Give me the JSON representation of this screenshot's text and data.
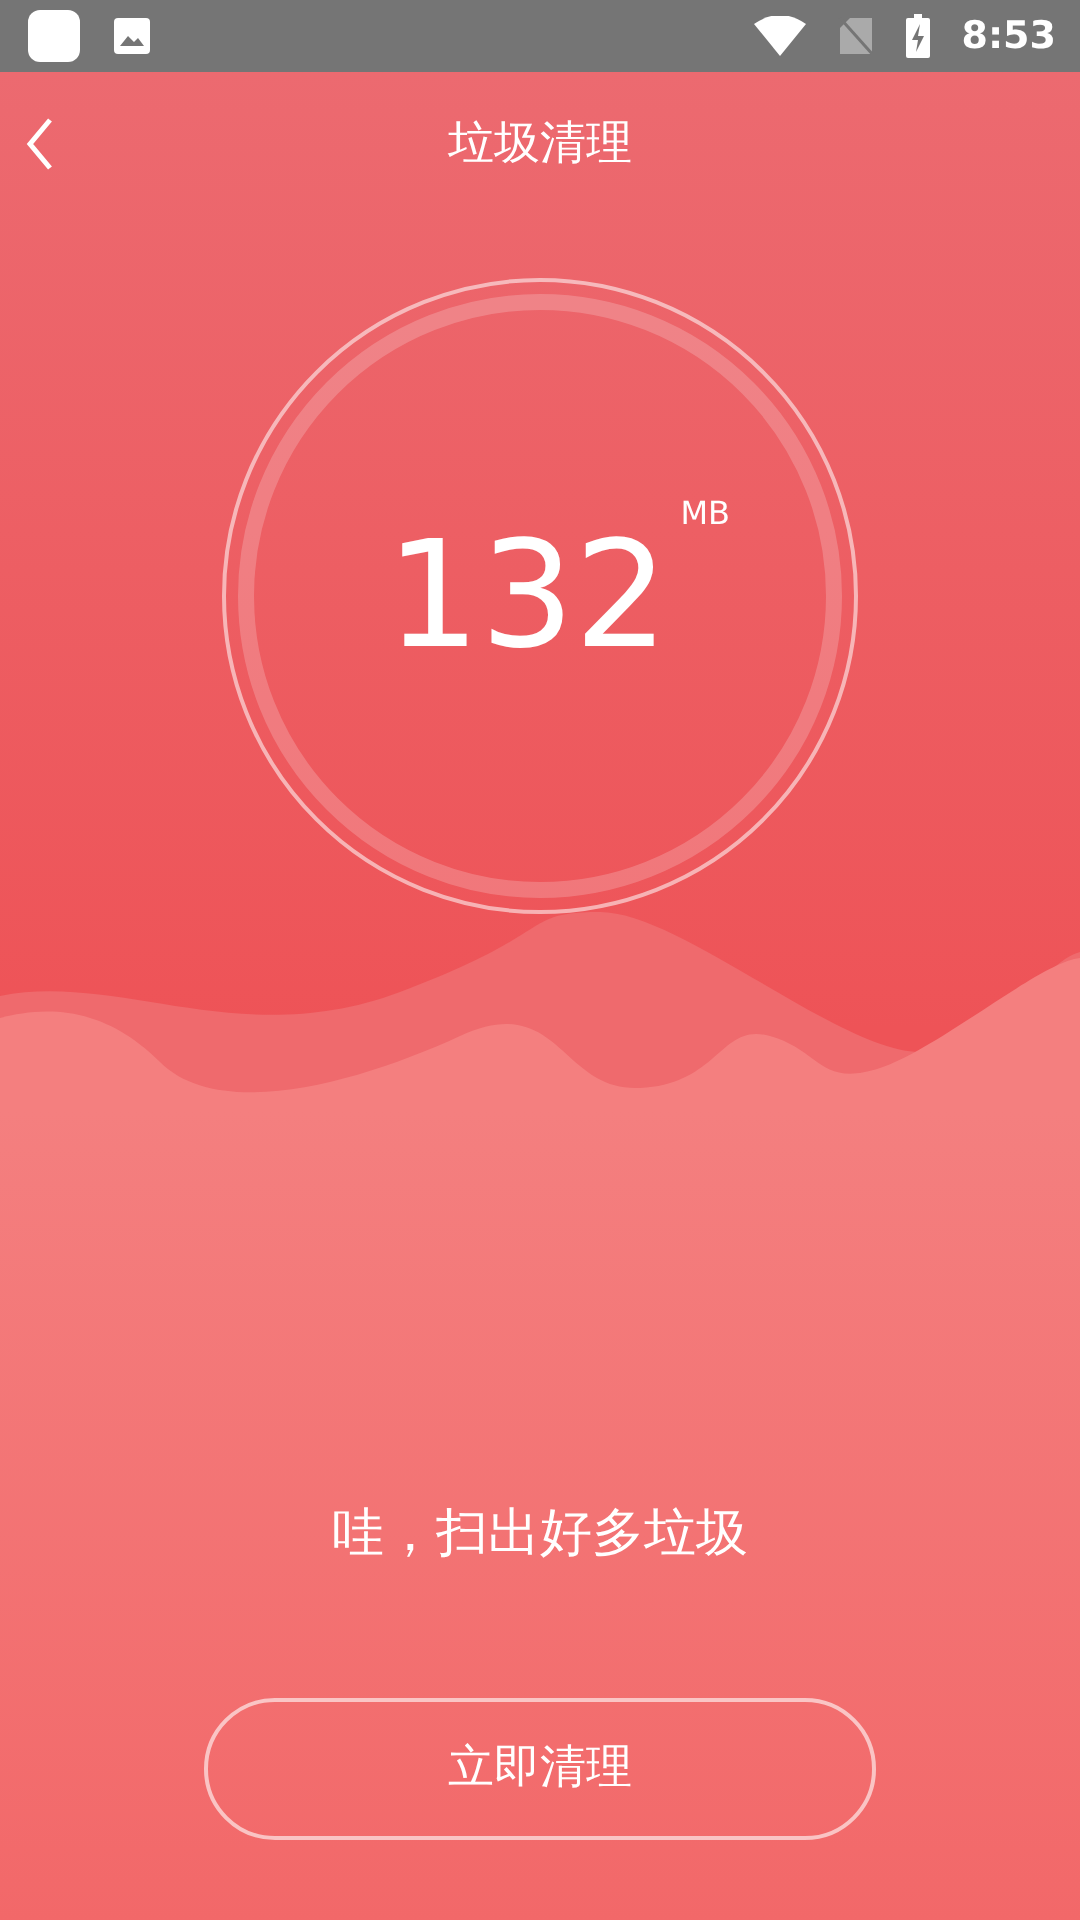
{
  "status_bar": {
    "time": "8:53"
  },
  "header": {
    "title": "垃圾清理"
  },
  "scan": {
    "amount": "132",
    "unit": "MB",
    "message": "哇，扫出好多垃圾"
  },
  "button": {
    "label": "立即清理"
  }
}
